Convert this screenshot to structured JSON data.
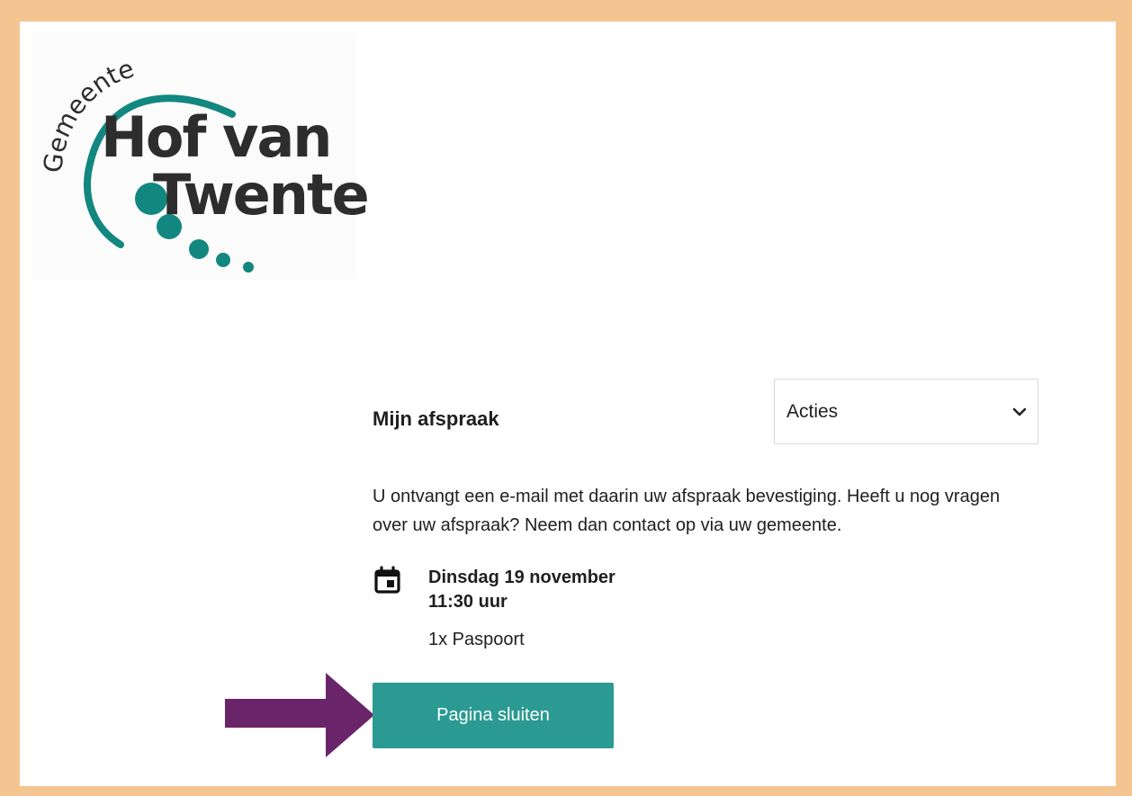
{
  "logo": {
    "prefix": "Gemeente",
    "line1": "Hof van",
    "line2": "Twente"
  },
  "appointment": {
    "title": "Mijn afspraak",
    "actions_label": "Acties",
    "message": "U ontvangt een e-mail met daarin uw afspraak bevestiging. Heeft u nog vragen over uw afspraak? Neem dan contact op via uw gemeente.",
    "date": "Dinsdag 19 november",
    "time": "11:30 uur",
    "service": "1x Paspoort",
    "close_label": "Pagina sluiten"
  },
  "icons": {
    "calendar": "calendar-icon",
    "chevron": "chevron-down-icon",
    "arrow": "arrow-right-icon"
  },
  "colors": {
    "frame": "#f5c591",
    "accent": "#2a9a92",
    "arrow": "#6a246a"
  }
}
